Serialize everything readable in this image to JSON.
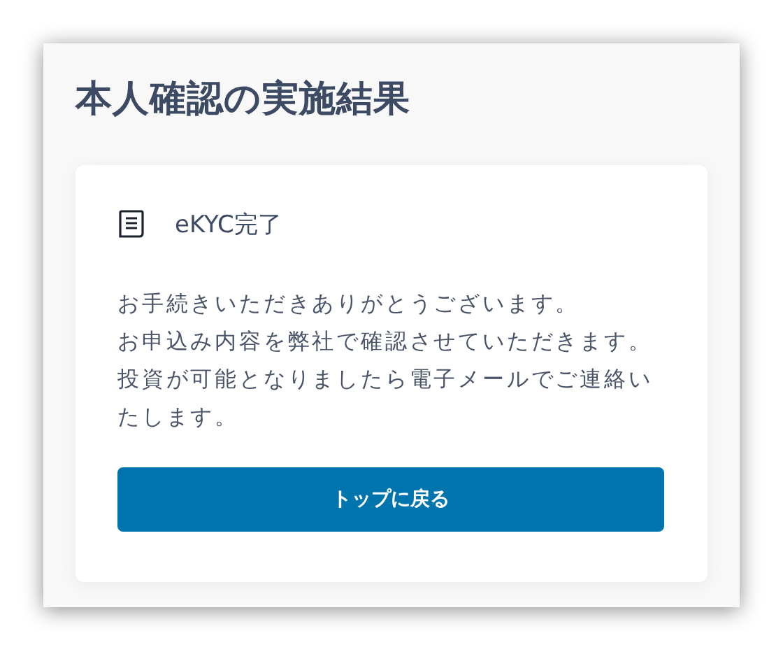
{
  "page": {
    "title": "本人確認の実施結果"
  },
  "card": {
    "heading": "eKYC完了",
    "message": [
      "お手続きいただきありがとうございます。",
      "お申込み内容を弊社で確認させていただきます。",
      "投資が可能となりましたら電子メールでご連絡いたします。"
    ],
    "button": "トップに戻る"
  }
}
